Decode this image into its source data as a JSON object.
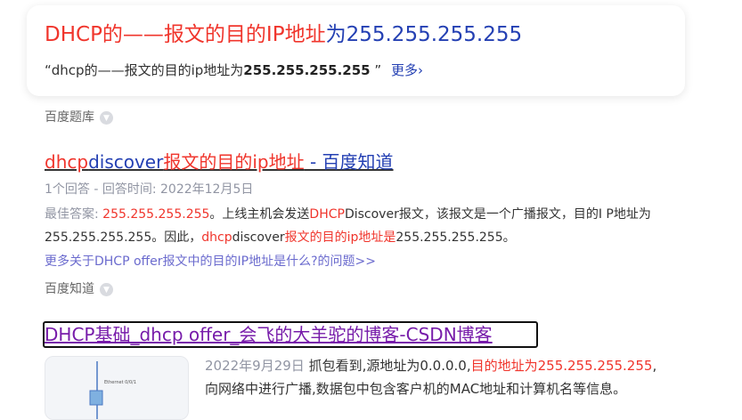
{
  "card": {
    "title_parts": [
      "DHCP的——报文的目的IP地址",
      "为",
      "255.255.255.255"
    ],
    "sub_prefix": "“dhcp的——报文的目的ip地址为",
    "sub_bold": "255.255.255.255",
    "sub_suffix": " ”",
    "more": "更多"
  },
  "source1": "百度题库",
  "result1": {
    "title_parts": [
      "dhcp",
      "discover",
      "报文的目的ip地址",
      " - 百度知道"
    ],
    "meta": "1个回答 - 回答时间: 2022年12月5日",
    "answer_label": "最佳答案: ",
    "answer_parts": [
      "255.255.255.255",
      "。上线主机会发送",
      "DHCP",
      "Discover报文，该报文是一个广播报文，目的I P地址为255.255.255.255。因此，",
      "dhcp",
      "discover",
      "报文的目的ip地址是",
      "255.255.255.255。"
    ],
    "more_link": "更多关于DHCP offer报文中的目的IP地址是什么?的问题>>"
  },
  "source2": "百度知道",
  "result2": {
    "title": "DHCP基础_dhcp offer_会飞的大羊驼的博客-CSDN博客",
    "date": "2022年9月29日",
    "text_parts": [
      " 抓包看到,源地址为0.0.0.0,",
      "目的地址为255.255.255.255",
      ",",
      "向网络中进行广播,数据包中包含客户机的MAC地址和计算机名等信息。"
    ],
    "thumb_label": "Ethernet 0/0/1"
  },
  "icons": {
    "chevron": "chevron-right-icon",
    "source_arrow": "chevron-down-icon"
  }
}
